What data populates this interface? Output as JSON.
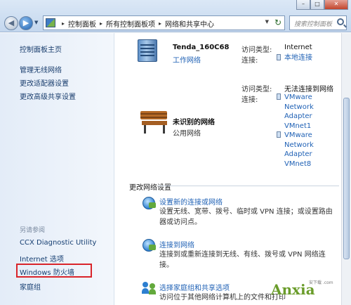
{
  "address_bar": {
    "crumbs": [
      "控制面板",
      "所有控制面板项",
      "网络和共享中心"
    ],
    "search_placeholder": "搜索控制面板"
  },
  "window_buttons": {
    "minimize": "–",
    "maximize": "□",
    "close": "✕"
  },
  "sidebar": {
    "links": [
      "控制面板主页",
      "管理无线网络",
      "更改适配器设置",
      "更改高级共享设置"
    ],
    "see_also_title": "另请参阅",
    "see_also": [
      "CCX Diagnostic Utility",
      "Internet 选项",
      "Windows 防火墙",
      "家庭组"
    ]
  },
  "networks": [
    {
      "name": "Tenda_160C68",
      "type": "工作网络",
      "access_label": "访问类型:",
      "access_value": "Internet",
      "conn_label": "连接:",
      "connections": [
        "本地连接"
      ]
    },
    {
      "name": "未识别的网络",
      "type": "公用网络",
      "access_label": "访问类型:",
      "access_value": "无法连接到网络",
      "conn_label": "连接:",
      "connections": [
        "VMware",
        "Network",
        "Adapter",
        "VMnet1",
        "VMware",
        "Network",
        "Adapter",
        "VMnet8"
      ]
    }
  ],
  "change_settings": {
    "title": "更改网络设置",
    "tasks": [
      {
        "link": "设置新的连接或网络",
        "desc": [
          "设置无线、宽带、拨号、临时或 VPN 连接；或设置路由",
          "器或访问点。"
        ]
      },
      {
        "link": "连接到网络",
        "desc": [
          "连接到或重新连接到无线、有线、拨号或 VPN 网络连接。"
        ]
      },
      {
        "link": "选择家庭组和共享选项",
        "desc": [
          "访问位于其他网络计算机上的文件和打印"
        ]
      }
    ]
  },
  "watermark": {
    "brand": "Anxia",
    "sub": "安下载 .com"
  }
}
